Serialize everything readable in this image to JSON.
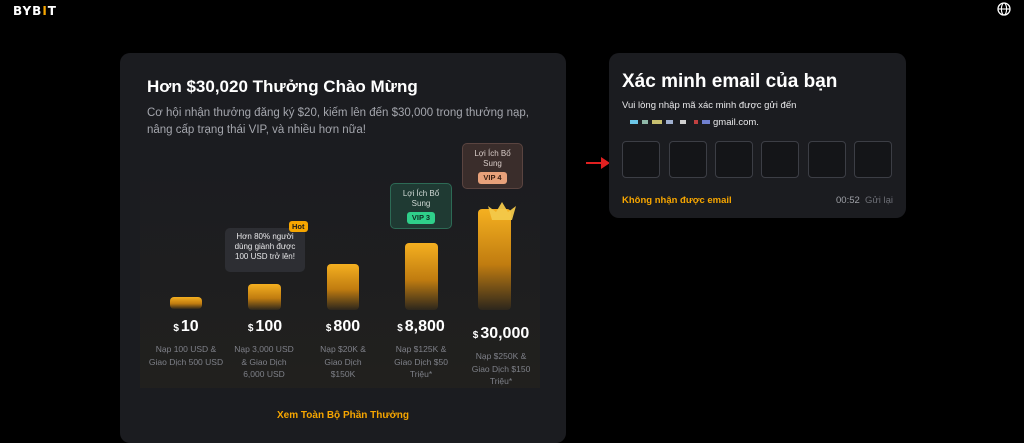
{
  "header": {
    "logo_left": "BYB",
    "logo_bar": "I",
    "logo_right": "T",
    "language_icon": "globe-icon"
  },
  "rewards": {
    "title": "Hơn $30,020 Thưởng Chào Mừng",
    "subtitle": "Cơ hội nhận thưởng đăng ký $20, kiếm lên đến $30,000 trong thưởng nạp, nâng cấp trạng thái VIP, và nhiều hơn nữa!",
    "currency_symbol": "$",
    "tiers": [
      {
        "amount": "10",
        "description": "Nạp 100 USD & Giao Dịch 500 USD",
        "level": 0.06
      },
      {
        "amount": "100",
        "description": "Nạp 3,000 USD & Giao Dịch 6,000 USD",
        "level": 0.17
      },
      {
        "amount": "800",
        "description": "Nạp $20K & Giao Dịch $150K",
        "level": 0.31
      },
      {
        "amount": "8,800",
        "description": "Nạp $125K & Giao Dịch $50 Triệu*",
        "level": 0.47
      },
      {
        "amount": "30,000",
        "description": "Nạp $250K & Giao Dịch $150 Triệu*",
        "level": 0.77
      }
    ],
    "hot_bubble": {
      "text": "Hơn 80% người dùng giành được 100 USD trở lên!",
      "badge": "Hot"
    },
    "vip3_bubble": {
      "text": "Lợi Ích Bổ Sung",
      "badge": "VIP 3"
    },
    "vip4_bubble": {
      "text": "Lợi Ích Bổ Sung",
      "badge": "VIP 4"
    },
    "view_all": "Xem Toàn Bộ Phần Thưởng",
    "colors": {
      "accent": "#f7a600",
      "vip3": "#2fcf8a",
      "vip4": "#e8a17a"
    }
  },
  "verify": {
    "title": "Xác minh email của bạn",
    "instruction": "Vui lòng nhập mã xác minh được gửi đến",
    "email_domain": "gmail.com.",
    "otp_values": [
      "",
      "",
      "",
      "",
      "",
      ""
    ],
    "no_email_link": "Không nhận được email",
    "timer": "00:52",
    "resend": "Gửi lại"
  }
}
